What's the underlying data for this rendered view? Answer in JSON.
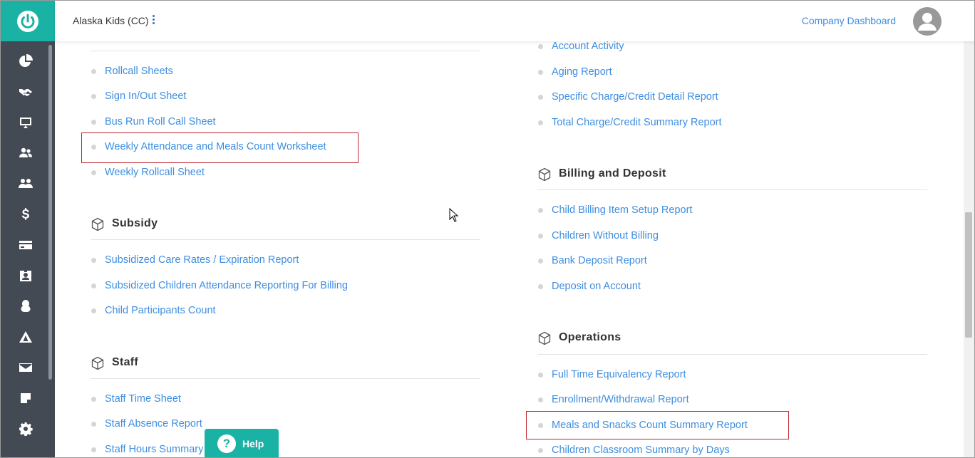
{
  "header": {
    "center_name": "Alaska Kids (CC)",
    "company_dashboard": "Company Dashboard"
  },
  "sidebar": {
    "icons": [
      "dashboard-pie-icon",
      "handshake-icon",
      "screen-icon",
      "users-icon",
      "family-icon",
      "dollar-icon",
      "credit-card-icon",
      "badge-icon",
      "tree-icon",
      "tent-icon",
      "envelope-icon",
      "note-icon",
      "gear-icon"
    ]
  },
  "left": {
    "attendance_items": [
      "Rollcall Sheets",
      "Sign In/Out Sheet",
      "Bus Run Roll Call Sheet",
      "Weekly Attendance and Meals Count Worksheet",
      "Weekly Rollcall Sheet"
    ],
    "subsidy_title": "Subsidy",
    "subsidy_items": [
      "Subsidized Care Rates / Expiration Report",
      "Subsidized Children Attendance Reporting For Billing",
      "Child Participants Count"
    ],
    "staff_title": "Staff",
    "staff_items": [
      "Staff Time Sheet",
      "Staff Absence Report",
      "Staff Hours Summary"
    ]
  },
  "right": {
    "accounts_items": [
      "Account Activity",
      "Aging Report",
      "Specific Charge/Credit Detail Report",
      "Total Charge/Credit Summary Report"
    ],
    "billing_title": "Billing and Deposit",
    "billing_items": [
      "Child Billing Item Setup Report",
      "Children Without Billing",
      "Bank Deposit Report",
      "Deposit on Account"
    ],
    "operations_title": "Operations",
    "operations_items": [
      "Full Time Equivalency Report",
      "Enrollment/Withdrawal Report",
      "Meals and Snacks Count Summary Report",
      "Children Classroom Summary by Days"
    ]
  },
  "help": {
    "label": "Help",
    "icon": "?"
  },
  "colors": {
    "brand": "#19b2a4",
    "sidebar": "#434a54",
    "link": "#3d8ee0",
    "highlight": "#c0262d"
  }
}
